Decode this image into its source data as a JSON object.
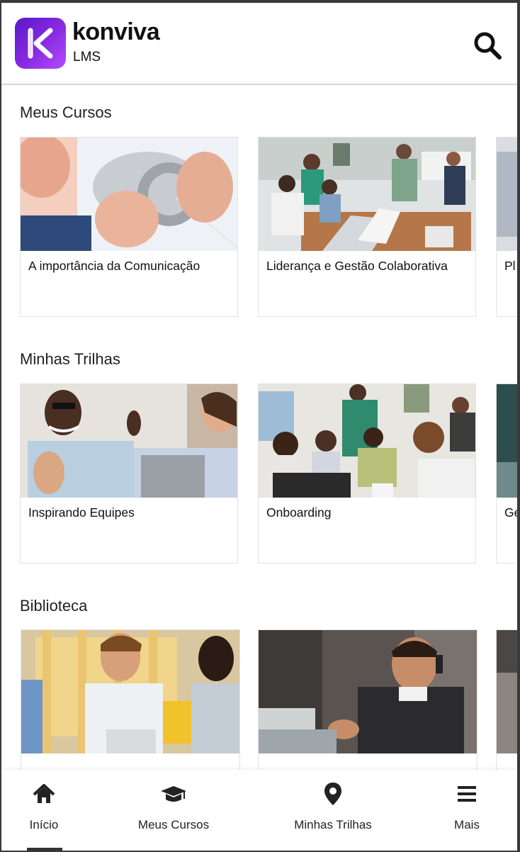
{
  "header": {
    "brand": "konviva",
    "sub": "LMS",
    "search_icon": "search-icon"
  },
  "sections": [
    {
      "title": "Meus Cursos",
      "cards": [
        {
          "title": "A importância da Comunicação"
        },
        {
          "title": "Liderança e Gestão Colaborativa"
        },
        {
          "title": "Pl"
        }
      ]
    },
    {
      "title": "Minhas Trilhas",
      "cards": [
        {
          "title": "Inspirando Equipes"
        },
        {
          "title": "Onboarding"
        },
        {
          "title": "Ge"
        }
      ]
    },
    {
      "title": "Biblioteca",
      "cards": [
        {
          "title": ""
        },
        {
          "title": ""
        },
        {
          "title": ""
        }
      ]
    }
  ],
  "nav": [
    {
      "label": "Início",
      "icon": "home-icon",
      "active": true
    },
    {
      "label": "Meus Cursos",
      "icon": "graduation-cap-icon"
    },
    {
      "label": "Minhas Trilhas",
      "icon": "map-pin-icon"
    },
    {
      "label": "Mais",
      "icon": "menu-icon"
    }
  ],
  "colors": {
    "brand_gradient_start": "#5a17c9",
    "brand_gradient_end": "#b44cff",
    "text": "#222222"
  }
}
